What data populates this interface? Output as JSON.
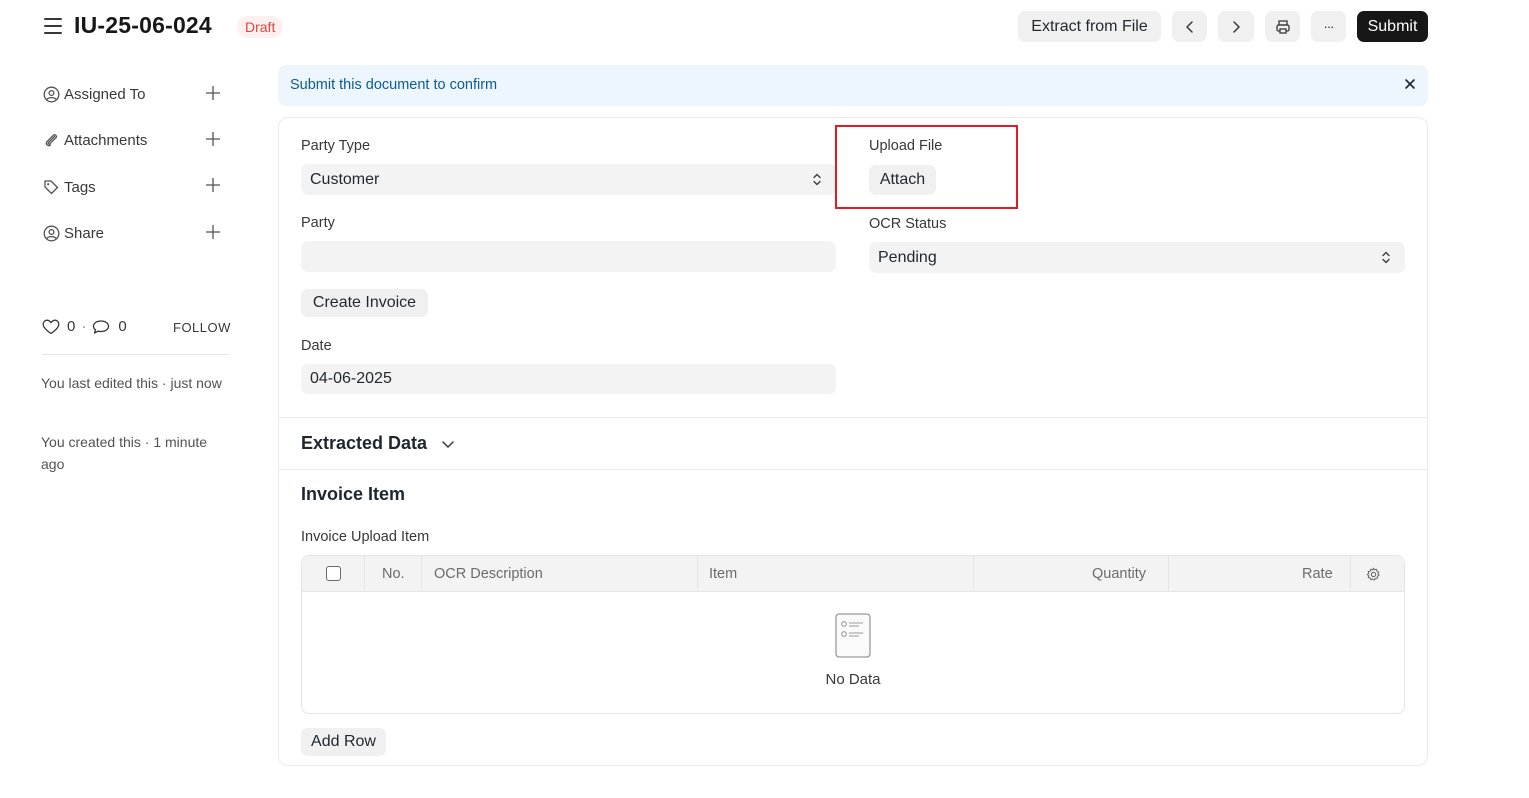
{
  "header": {
    "title": "IU-25-06-024",
    "status": "Draft",
    "extract_label": "Extract from File",
    "submit_label": "Submit",
    "more_label": "···"
  },
  "sidebar": {
    "items": [
      {
        "label": "Assigned To",
        "icon": "assign-user-icon"
      },
      {
        "label": "Attachments",
        "icon": "paperclip-icon"
      },
      {
        "label": "Tags",
        "icon": "tag-icon"
      },
      {
        "label": "Share",
        "icon": "share-user-icon"
      }
    ],
    "likes": "0",
    "comments": "0",
    "follow_label": "FOLLOW",
    "last_edited": "You last edited this · just now",
    "created": "You created this · 1 minute ago"
  },
  "banner": {
    "text": "Submit this document to confirm"
  },
  "form": {
    "party_type_label": "Party Type",
    "party_type_value": "Customer",
    "upload_file_label": "Upload File",
    "attach_label": "Attach",
    "party_label": "Party",
    "party_value": "",
    "ocr_status_label": "OCR Status",
    "ocr_status_value": "Pending",
    "create_invoice_label": "Create Invoice",
    "date_label": "Date",
    "date_value": "04-06-2025"
  },
  "sections": {
    "extracted_data": "Extracted Data",
    "invoice_item": "Invoice Item"
  },
  "table": {
    "label": "Invoice Upload Item",
    "columns": [
      "No.",
      "OCR Description",
      "Item",
      "Quantity",
      "Rate"
    ],
    "empty_text": "No Data",
    "add_row_label": "Add Row"
  },
  "colors": {
    "accent": "#171717",
    "draft_badge": "#d9463e",
    "banner_bg": "#edf6fd",
    "banner_text": "#0c5c93",
    "highlight": "#e31b23"
  }
}
